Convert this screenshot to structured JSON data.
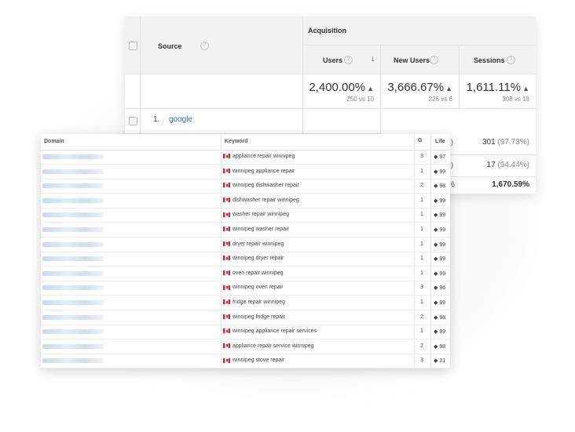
{
  "analytics": {
    "acquisition_label": "Acquisition",
    "source_label": "Source",
    "help_glyph": "?",
    "columns": {
      "users": "Users",
      "new_users": "New Users",
      "sessions": "Sessions"
    },
    "sort_arrow": "↓",
    "totals": {
      "users_pct": "2,400.00%",
      "users_vs": "250 vs 10",
      "new_users_pct": "3,666.67%",
      "new_users_vs": "226 vs 6",
      "sessions_pct": "1,611.11%",
      "sessions_vs": "308 vs 18",
      "up_glyph": "▲"
    },
    "rows": [
      {
        "num": "1.",
        "source": "google"
      }
    ],
    "side_values": [
      {
        "edge": ")",
        "main": "301",
        "sub": "(97.73%)"
      },
      {
        "edge": ")",
        "main": "17",
        "sub": "(94.44%)"
      },
      {
        "edge": "6",
        "main": "1,670.59%",
        "sub": ""
      }
    ]
  },
  "keywords": {
    "headers": {
      "domain": "Domain",
      "keyword": "Keyword",
      "google": "G",
      "life": "Life"
    },
    "rows": [
      {
        "keyword": "appliance repair winnipeg",
        "pos": "3",
        "life": "◆ 97"
      },
      {
        "keyword": "winnipeg appliance repair",
        "pos": "1",
        "life": "◆ 99"
      },
      {
        "keyword": "winnipeg dishwasher repair",
        "pos": "2",
        "life": "◆ 98"
      },
      {
        "keyword": "dishwasher repair winnipeg",
        "pos": "1",
        "life": "◆ 99"
      },
      {
        "keyword": "washer repair winnipeg",
        "pos": "1",
        "life": "◆ 99"
      },
      {
        "keyword": "winnipeg washer repair",
        "pos": "1",
        "life": "◆ 99"
      },
      {
        "keyword": "dryer repair winnipeg",
        "pos": "1",
        "life": "◆ 99"
      },
      {
        "keyword": "winnipeg dryer repair",
        "pos": "1",
        "life": "◆ 99"
      },
      {
        "keyword": "oven repair winnipeg",
        "pos": "1",
        "life": "◆ 99"
      },
      {
        "keyword": "winnipeg oven repair",
        "pos": "3",
        "life": "◆ 96"
      },
      {
        "keyword": "fridge repair winnipeg",
        "pos": "1",
        "life": "◆ 99"
      },
      {
        "keyword": "winnipeg fridge repair",
        "pos": "2",
        "life": "◆ 98"
      },
      {
        "keyword": "winnipeg appliance repair services",
        "pos": "1",
        "life": "◆ 99"
      },
      {
        "keyword": "appliance repair service winnipeg",
        "pos": "2",
        "life": "◆ 98"
      },
      {
        "keyword": "winnipeg stove repair",
        "pos": "3",
        "life": "◆ 21"
      }
    ]
  },
  "colors": {
    "link": "#2a6ebb",
    "flag_red": "#d62a2a"
  }
}
